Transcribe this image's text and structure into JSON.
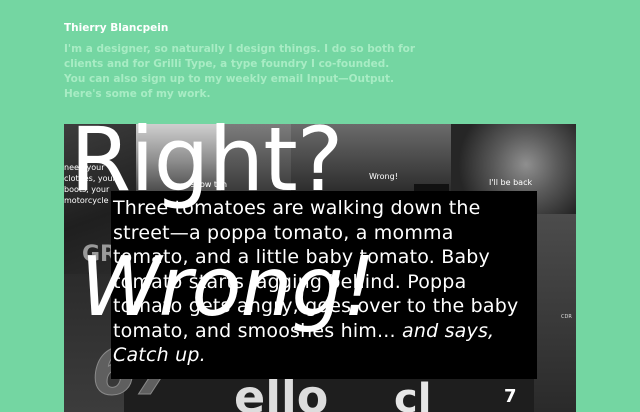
{
  "site": {
    "name": "Thierry Blancpein"
  },
  "intro": {
    "lines": [
      "I'm a designer, so naturally I design things. I do so both for",
      "clients and for Grilli Type, a type foundry I co-founded.",
      "You can also sign up to my weekly email Input—Output.",
      "Here's some of my work."
    ]
  },
  "work": {
    "captions": [
      "need your clothes, your boots, your motorcycle",
      "s show tim",
      "Wrong!",
      "I'll be back"
    ],
    "background_letters": [
      "GR",
      "67",
      "ello",
      "cl",
      "7"
    ],
    "badge": "CDR",
    "headline_top": "Right?",
    "headline_bottom": "Wrong!",
    "story_plain": "Three tomatoes are walking down the street—a poppa tomato, a momma tomato, and a little baby tomato. Baby tomato starts lagging behind. Poppa tomato gets angry, goes over to the baby tomato, and smooshes him...",
    "story_italic": " and says, Catch up."
  }
}
